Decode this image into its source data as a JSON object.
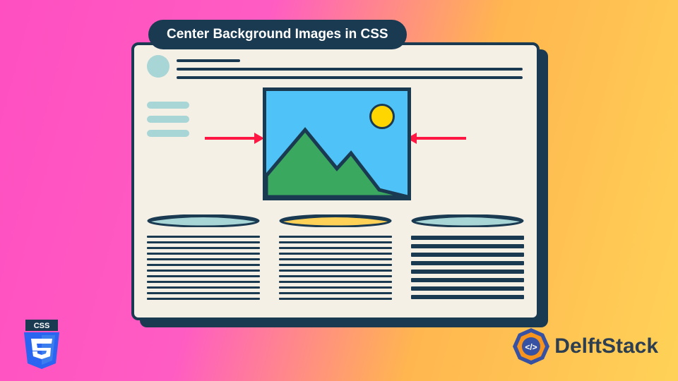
{
  "title": "Center Background Images in CSS",
  "css_badge": "CSS",
  "brand": "DelftStack",
  "colors": {
    "dark": "#1a3a52",
    "accent": "#ff1744",
    "sky": "#4fc3f7",
    "sun": "#ffd600",
    "mountain": "#3ba860"
  }
}
